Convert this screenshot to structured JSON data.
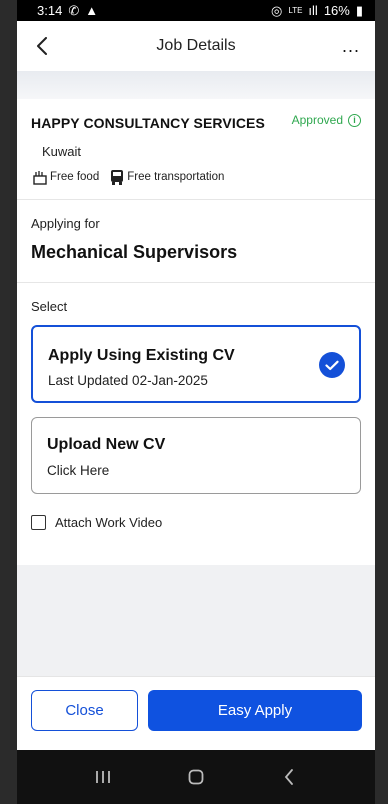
{
  "status_bar": {
    "time": "3:14",
    "battery": "16%",
    "network": "LTE"
  },
  "appbar": {
    "title": "Job Details",
    "more_label": "..."
  },
  "company": {
    "name": "HAPPY CONSULTANCY SERVICES",
    "status": "Approved",
    "location": "Kuwait",
    "perks": [
      "Free food",
      "Free transportation"
    ]
  },
  "applying": {
    "label": "Applying for",
    "job_title": "Mechanical Supervisors"
  },
  "select": {
    "label": "Select",
    "options": [
      {
        "title": "Apply Using Existing CV",
        "subtitle": "Last Updated 02-Jan-2025",
        "selected": true
      },
      {
        "title": "Upload New CV",
        "subtitle": "Click Here",
        "selected": false
      }
    ]
  },
  "attach_video": {
    "label": "Attach Work Video",
    "checked": false
  },
  "actions": {
    "close": "Close",
    "apply": "Easy Apply"
  },
  "colors": {
    "accent": "#1450d8",
    "approved": "#2fa84f"
  }
}
